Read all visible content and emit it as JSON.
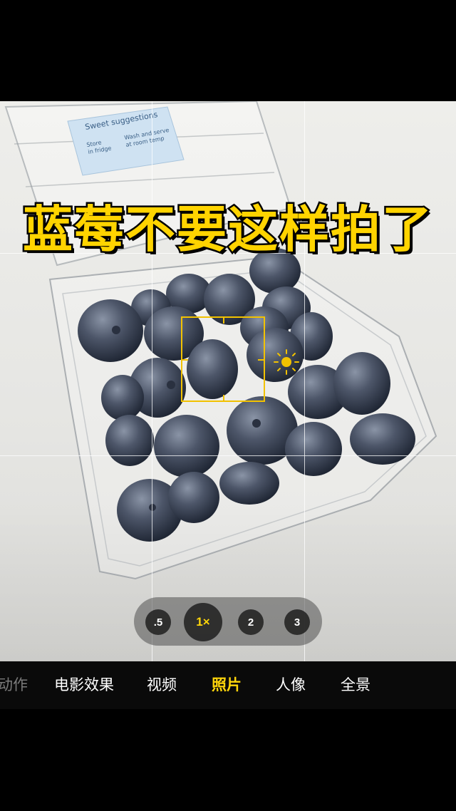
{
  "overlay_title": "蓝莓不要这样拍了",
  "zoom": {
    "options": [
      ".5",
      "1×",
      "2",
      "3"
    ],
    "selected": "1×"
  },
  "modes": {
    "items": [
      "动作",
      "电影效果",
      "视频",
      "照片",
      "人像",
      "全景"
    ],
    "selected": "照片"
  },
  "label": {
    "line1": "Sweet suggestions",
    "left_a": "Store",
    "left_b": "in fridge",
    "right_a": "Wash and serve",
    "right_b": "at room temp"
  },
  "colors": {
    "accent": "#ffd60a",
    "focus": "#f2c200",
    "title": "#ffd400"
  },
  "icons": {
    "exposure": "sun-icon"
  }
}
